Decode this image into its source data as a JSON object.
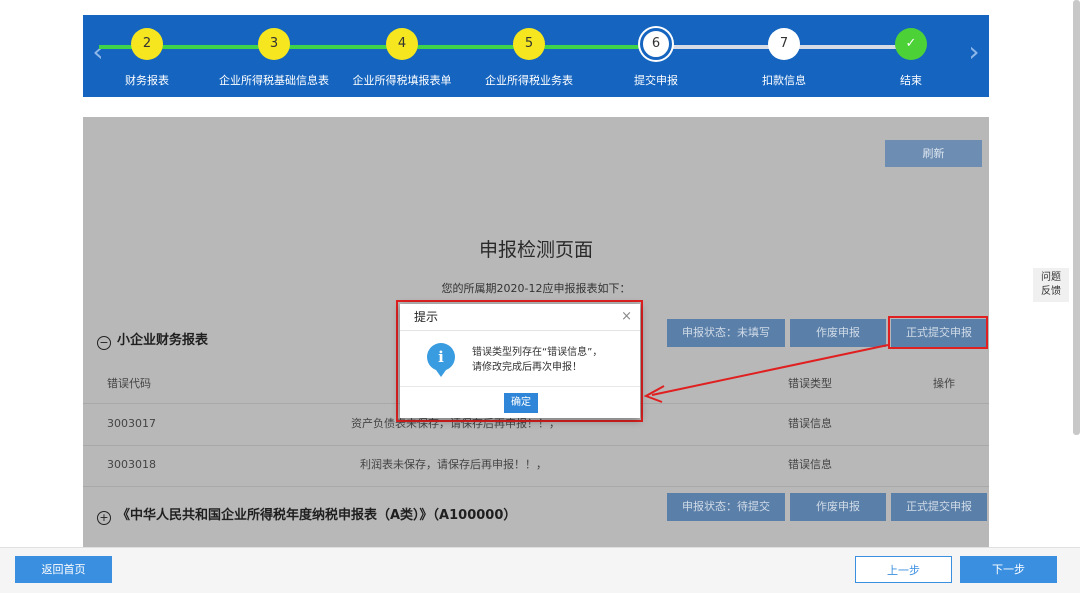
{
  "stepper": {
    "steps": [
      {
        "num": "2",
        "label": "财务报表"
      },
      {
        "num": "3",
        "label": "企业所得税基础信息表"
      },
      {
        "num": "4",
        "label": "企业所得税填报表单"
      },
      {
        "num": "5",
        "label": "企业所得税业务表"
      },
      {
        "num": "6",
        "label": "提交申报"
      },
      {
        "num": "7",
        "label": "扣款信息"
      },
      {
        "num": "",
        "label": "结束"
      }
    ],
    "colors": {
      "done": "#f5e61f",
      "current": "#ffffff",
      "pending": "#ffffff",
      "end": "#4cd137",
      "line_done": "#3fd34a",
      "line_pending": "#d7dbe6"
    }
  },
  "panel": {
    "refresh_label": "刷新",
    "page_title": "申报检测页面",
    "period_text": "您的所属期2020-12应申报报表如下："
  },
  "section1": {
    "title": "小企业财务报表",
    "status_label": "申报状态：未填写",
    "void_label": "作废申报",
    "submit_label": "正式提交申报",
    "columns": [
      "错误代码",
      "错误类型",
      "操作"
    ],
    "rows": [
      {
        "code": "3003017",
        "desc": "资产负债表未保存，请保存后再申报！！，",
        "type": "错误信息"
      },
      {
        "code": "3003018",
        "desc": "利润表未保存，请保存后再申报！！，",
        "type": "错误信息"
      }
    ]
  },
  "section2": {
    "title": "《中华人民共和国企业所得税年度纳税申报表（A类）》（A100000）",
    "status_label": "申报状态：待提交",
    "void_label": "作废申报",
    "submit_label": "正式提交申报"
  },
  "modal": {
    "title": "提示",
    "close": "×",
    "message_line1": "错误类型列存在“错误信息”，",
    "message_line2": "请修改完成后再次申报！",
    "ok_label": "确定",
    "icon_glyph": "i"
  },
  "feedback": {
    "line1": "问题",
    "line2": "反馈"
  },
  "footer": {
    "home_label": "返回首页",
    "prev_label": "上一步",
    "next_label": "下一步"
  }
}
